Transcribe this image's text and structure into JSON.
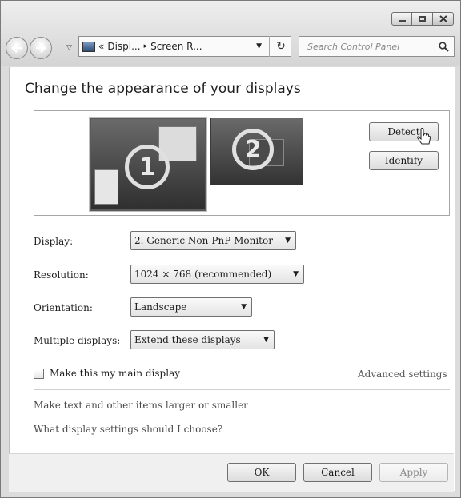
{
  "window": {
    "buttons": [
      "minimize-icon",
      "maximize-icon",
      "close-icon"
    ]
  },
  "nav": {
    "back_icon": "back-arrow-icon",
    "forward_icon": "forward-arrow-icon",
    "recent_icon": "chevron-down-icon"
  },
  "address": {
    "overflow": "«",
    "crumb1": "Displ...",
    "sep": "▸",
    "crumb2": "Screen R...",
    "dropdown": "▼",
    "refresh": "↻"
  },
  "search": {
    "placeholder": "Search Control Panel"
  },
  "page": {
    "title": "Change the appearance of your displays"
  },
  "monitors": {
    "monitor1_label": "1",
    "monitor2_label": "2"
  },
  "buttons": {
    "detect": "Detect",
    "identify": "Identify"
  },
  "settings": {
    "display_label": "Display:",
    "display_value": "2. Generic Non-PnP Monitor",
    "resolution_label": "Resolution:",
    "resolution_value": "1024 × 768 (recommended)",
    "orientation_label": "Orientation:",
    "orientation_value": "Landscape",
    "multiple_label": "Multiple displays:",
    "multiple_value": "Extend these displays"
  },
  "main_display": {
    "label": "Make this my main display",
    "checked": false
  },
  "links": {
    "advanced": "Advanced settings",
    "text_size": "Make text and other items larger or smaller",
    "help": "What display settings should I choose?"
  },
  "footer": {
    "ok": "OK",
    "cancel": "Cancel",
    "apply": "Apply"
  }
}
